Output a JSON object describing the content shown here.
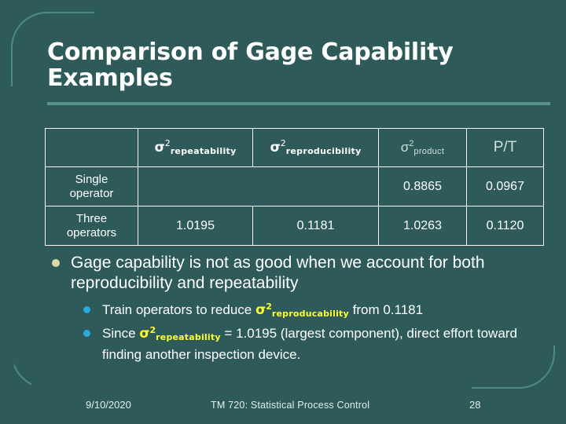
{
  "slide": {
    "title": "Comparison of Gage Capability Examples",
    "background_color": "#2e5b59",
    "accent_rule_color": "#58918c",
    "frame_color": "#4d8b85"
  },
  "table": {
    "headers": [
      {
        "label": "",
        "style": "blank"
      },
      {
        "sigma": "σ",
        "exp": "2",
        "sub": "repeatability",
        "style": "bold-white"
      },
      {
        "sigma": "σ",
        "exp": "2",
        "sub": "reproducibility",
        "style": "bold-white"
      },
      {
        "sigma": "σ",
        "exp": "2",
        "sub": "product",
        "style": "light-gray"
      },
      {
        "label": "P/T",
        "style": "light-gray"
      }
    ],
    "rows": [
      {
        "label_line1": "Single",
        "label_line2": "operator",
        "repeatability": "",
        "reproducibility": "",
        "merged_middle": true,
        "product": "0.8865",
        "pt": "0.0967"
      },
      {
        "label_line1": "Three",
        "label_line2": "operators",
        "repeatability": "1.0195",
        "reproducibility": "0.1181",
        "merged_middle": false,
        "product": "1.0263",
        "pt": "0.1120"
      }
    ]
  },
  "bullets": {
    "main": "Gage capability is not as good when we account for both reproducibility and repeatability",
    "sub": [
      {
        "pre": "Train operators to reduce ",
        "sigma": "σ",
        "exp": "2",
        "subscript": "reproducability",
        "post": " from 0.1181",
        "marker_color": "#2aa8e0"
      },
      {
        "pre": "Since ",
        "sigma": "σ",
        "exp": "2",
        "subscript": "repeatability",
        "post": " = 1.0195 (largest component), direct effort toward finding another inspection device.",
        "marker_color": "#2aa8e0"
      }
    ],
    "main_marker_color": "#ddd9ab"
  },
  "footer": {
    "date": "9/10/2020",
    "center": "TM 720: Statistical Process Control",
    "page": "28"
  }
}
